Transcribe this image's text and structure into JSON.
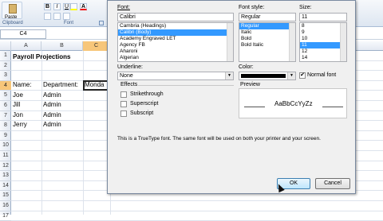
{
  "ribbon": {
    "paste": "Paste",
    "clipboard": "Clipboard",
    "font_group": "Font",
    "bold": "B",
    "italic": "I",
    "underline": "U"
  },
  "namebox": "C4",
  "columns": [
    "A",
    "B",
    "C"
  ],
  "rows": [
    "1",
    "2",
    "3",
    "4",
    "5",
    "6",
    "7",
    "8",
    "9",
    "10",
    "11",
    "12",
    "13",
    "14",
    "15",
    "16",
    "17"
  ],
  "cells": {
    "title": "Payroll Projections",
    "a4": "Name:",
    "b4": "Department:",
    "c4": "Monda",
    "names": [
      "Joe",
      "Jill",
      "Jon",
      "Jerry"
    ],
    "depts": [
      "Admin",
      "Admin",
      "Admin",
      "Admin"
    ]
  },
  "dialog": {
    "font_label": "Font:",
    "font_value": "Calibri",
    "fonts": [
      "Cambria (Headings)",
      "Calibri (Body)",
      "Academy Engraved LET",
      "Agency FB",
      "Aharoni",
      "Algerian"
    ],
    "style_label": "Font style:",
    "style_value": "Regular",
    "styles": [
      "Regular",
      "Italic",
      "Bold",
      "Bold Italic"
    ],
    "size_label": "Size:",
    "size_value": "11",
    "sizes": [
      "8",
      "9",
      "10",
      "11",
      "12",
      "14"
    ],
    "underline_label": "Underline:",
    "underline_value": "None",
    "color_label": "Color:",
    "normal_font": "Normal font",
    "effects_label": "Effects",
    "strike": "Strikethrough",
    "superscript": "Superscript",
    "subscript": "Subscript",
    "preview_label": "Preview",
    "preview_text": "AaBbCcYyZz",
    "note": "This is a TrueType font.  The same font will be used on both your printer and your screen.",
    "ok": "OK",
    "cancel": "Cancel"
  }
}
